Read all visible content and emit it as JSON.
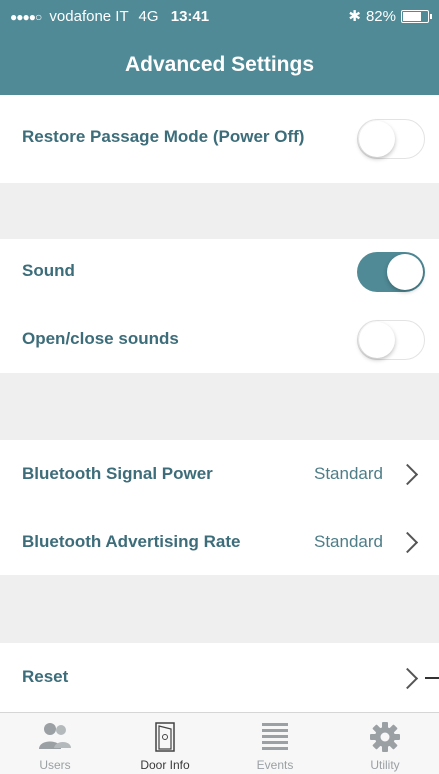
{
  "status_bar": {
    "signal": "●●●●○",
    "carrier": "vodafone IT",
    "network": "4G",
    "time": "13:41",
    "bluetooth": "✱",
    "battery": "82%",
    "battery_level": 0.82
  },
  "header": {
    "title": "Advanced Settings",
    "background_color": "#4f8a96"
  },
  "settings": {
    "restore_passage": {
      "label": "Restore Passage Mode (Power Off)",
      "enabled": false
    },
    "sound": {
      "label": "Sound",
      "enabled": true
    },
    "open_close_sounds": {
      "label": "Open/close sounds",
      "enabled": false
    },
    "bt_signal_power": {
      "label": "Bluetooth Signal Power",
      "value": "Standard"
    },
    "bt_advertising_rate": {
      "label": "Bluetooth Advertising Rate",
      "value": "Standard"
    },
    "reset": {
      "label": "Reset"
    }
  },
  "tabs": [
    {
      "label": "Users",
      "icon": "users-icon",
      "active": false
    },
    {
      "label": "Door Info",
      "icon": "door-icon",
      "active": true
    },
    {
      "label": "Events",
      "icon": "events-list-icon",
      "active": false
    },
    {
      "label": "Utility",
      "icon": "gear-icon",
      "active": false
    }
  ]
}
